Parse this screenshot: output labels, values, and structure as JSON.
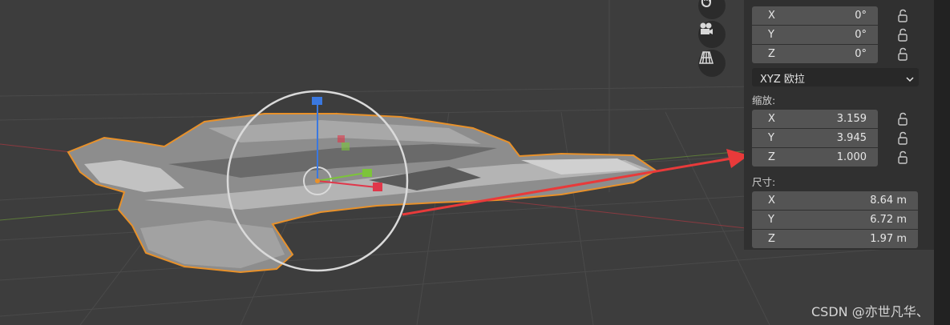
{
  "properties": {
    "rotation": {
      "x": {
        "axis": "X",
        "value": "0°"
      },
      "y": {
        "axis": "Y",
        "value": "0°"
      },
      "z": {
        "axis": "Z",
        "value": "0°"
      },
      "mode": "XYZ 欧拉"
    },
    "scale": {
      "label": "缩放:",
      "x": {
        "axis": "X",
        "value": "3.159"
      },
      "y": {
        "axis": "Y",
        "value": "3.945"
      },
      "z": {
        "axis": "Z",
        "value": "1.000"
      }
    },
    "dimensions": {
      "label": "尺寸:",
      "x": {
        "axis": "X",
        "value": "8.64 m"
      },
      "y": {
        "axis": "Y",
        "value": "6.72 m"
      },
      "z": {
        "axis": "Z",
        "value": "1.97 m"
      }
    }
  },
  "nav_icons": [
    "hand-pan-icon",
    "camera-icon",
    "grid-perspective-icon"
  ],
  "watermark": "CSDN @亦世凡华、",
  "colors": {
    "viewport_bg": "#3d3d3d",
    "panel_bg": "#303030",
    "field_bg": "#545454",
    "selection_outline": "#e8912a",
    "arrow": "#e83a3a",
    "gizmo_x": "#e0374a",
    "gizmo_y": "#7cc43a",
    "gizmo_z": "#3a78e0"
  }
}
